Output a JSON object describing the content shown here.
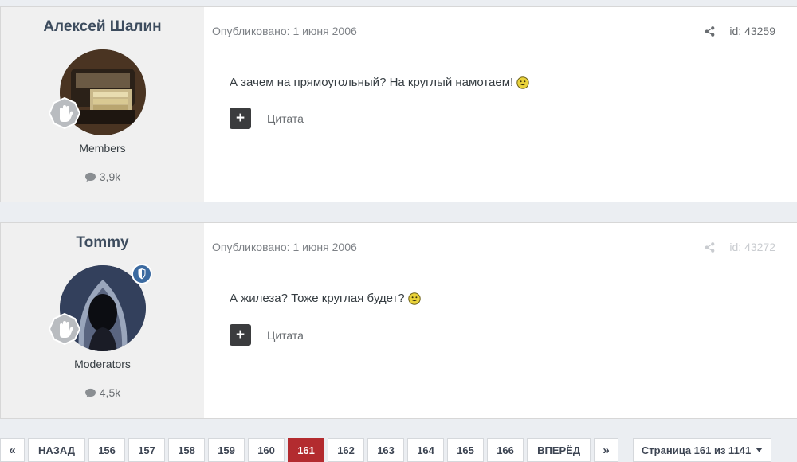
{
  "posts": [
    {
      "author": "Алексей Шалин",
      "group": "Members",
      "post_count": "3,9k",
      "published": "Опубликовано: 1 июня 2006",
      "post_id": "id: 43259",
      "text": "А зачем на прямоугольный? На круглый намотаем!",
      "quote_label": "Цитата",
      "avatar_icon": "avatar-cassette",
      "moderator_badge": false
    },
    {
      "author": "Tommy",
      "group": "Moderators",
      "post_count": "4,5k",
      "published": "Опубликовано: 1 июня 2006",
      "post_id": "id: 43272",
      "text": "А жилеза? Тоже круглая будет?",
      "quote_label": "Цитата",
      "avatar_icon": "avatar-hooded-figure",
      "moderator_badge": true
    }
  ],
  "pagination": {
    "first": "«",
    "prev": "НАЗАД",
    "pages": [
      "156",
      "157",
      "158",
      "159",
      "160",
      "161",
      "162",
      "163",
      "164",
      "165",
      "166"
    ],
    "current": "161",
    "next": "ВПЕРЁД",
    "last": "»",
    "jump_label": "Страница 161 из 1141"
  },
  "colors": {
    "accent": "#b32b2f",
    "author_name": "#3d4c5e",
    "moderator_badge": "#3b6aa0"
  }
}
